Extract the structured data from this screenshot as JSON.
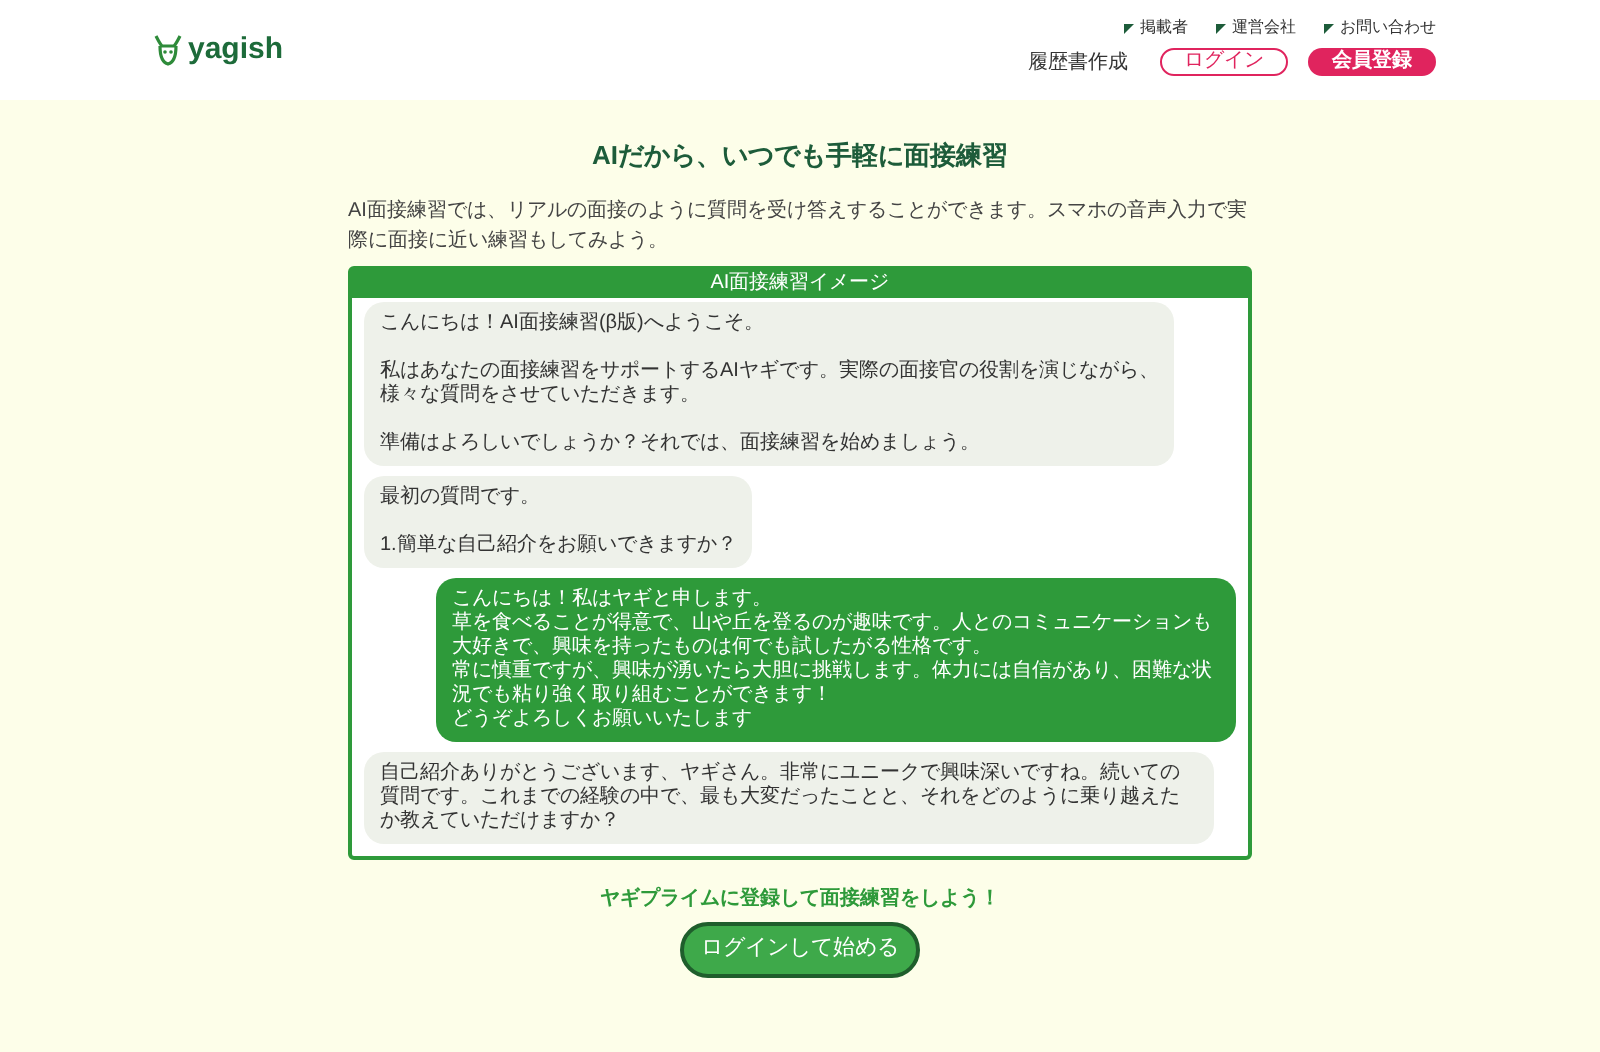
{
  "header": {
    "logo": "yagish",
    "top_links": [
      "掲載者",
      "運営会社",
      "お問い合わせ"
    ],
    "nav_link": "履歴書作成",
    "login_button": "ログイン",
    "register_button": "会員登録"
  },
  "title": "AIだから、いつでも手軽に面接練習",
  "description": "AI面接練習では、リアルの面接のように質問を受け答えすることができます。スマホの音声入力で実際に面接に近い練習もしてみよう。",
  "chat": {
    "title": "AI面接練習イメージ",
    "messages": [
      {
        "kind": "bot",
        "paragraphs": [
          [
            "こんにちは！AI面接練習(β版)へようこそ。"
          ],
          [
            "私はあなたの面接練習をサポートするAIヤギです。実際の面接官の役割を演じながら、",
            "様々な質問をさせていただきます。"
          ],
          [
            "準備はよろしいでしょうか？それでは、面接練習を始めましょう。"
          ]
        ]
      },
      {
        "kind": "bot",
        "paragraphs": [
          [
            "最初の質問です。"
          ],
          [
            "1.簡単な自己紹介をお願いできますか？"
          ]
        ]
      },
      {
        "kind": "user",
        "paragraphs": [
          [
            "こんにちは！私はヤギと申します。",
            "草を食べることが得意で、山や丘を登るのが趣味です。人とのコミュニケーションも大好きで、興味を持ったものは何でも試したがる性格です。",
            "常に慎重ですが、興味が湧いたら大胆に挑戦します。体力には自信があり、困難な状況でも粘り強く取り組むことができます！",
            "どうぞよろしくお願いいたします"
          ]
        ]
      },
      {
        "kind": "bot",
        "paragraphs": [
          [
            "自己紹介ありがとうございます、ヤギさん。非常にユニークで興味深いですね。続いての質問です。これまでの経験の中で、最も大変だったことと、それをどのように乗り越えたか教えていただけますか？"
          ]
        ]
      }
    ]
  },
  "cta": {
    "text": "ヤギプライムに登録して面接練習をしよう！",
    "button": "ログインして始める"
  }
}
